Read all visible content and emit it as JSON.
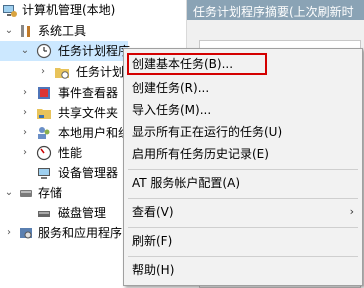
{
  "tree": {
    "root": "计算机管理(本地)",
    "system_tools": "系统工具",
    "task_scheduler": "任务计划程序",
    "task_scheduler_lib": "任务计划",
    "event_viewer": "事件查看器",
    "shared_folders": "共享文件夹",
    "local_users": "本地用户和组",
    "performance": "性能",
    "device_manager": "设备管理器",
    "storage": "存储",
    "disk_mgmt": "磁盘管理",
    "services": "服务和应用程序"
  },
  "right": {
    "header": "任务计划程序摘要(上次刷新时"
  },
  "menu": {
    "items": [
      "创建基本任务(B)...",
      "创建任务(R)...",
      "导入任务(M)...",
      "显示所有正在运行的任务(U)",
      "启用所有任务历史记录(E)",
      "AT 服务帐户配置(A)",
      "查看(V)",
      "刷新(F)",
      "帮助(H)"
    ],
    "submenu_arrow": "›"
  }
}
